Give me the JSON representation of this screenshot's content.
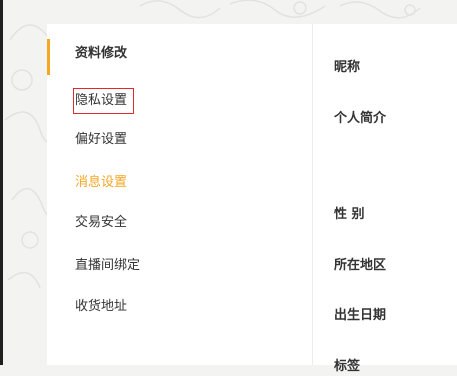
{
  "sidebar": {
    "items": [
      {
        "label": "资料修改"
      },
      {
        "label": "隐私设置"
      },
      {
        "label": "偏好设置"
      },
      {
        "label": "消息设置"
      },
      {
        "label": "交易安全"
      },
      {
        "label": "直播间绑定"
      },
      {
        "label": "收货地址"
      }
    ]
  },
  "form": {
    "labels": [
      {
        "label": "昵称"
      },
      {
        "label": "个人简介"
      },
      {
        "label": "性 别"
      },
      {
        "label": "所在地区"
      },
      {
        "label": "出生日期"
      },
      {
        "label": "标签"
      }
    ]
  },
  "colors": {
    "accent": "#f5a623",
    "highlight_box": "#e02b2b"
  }
}
